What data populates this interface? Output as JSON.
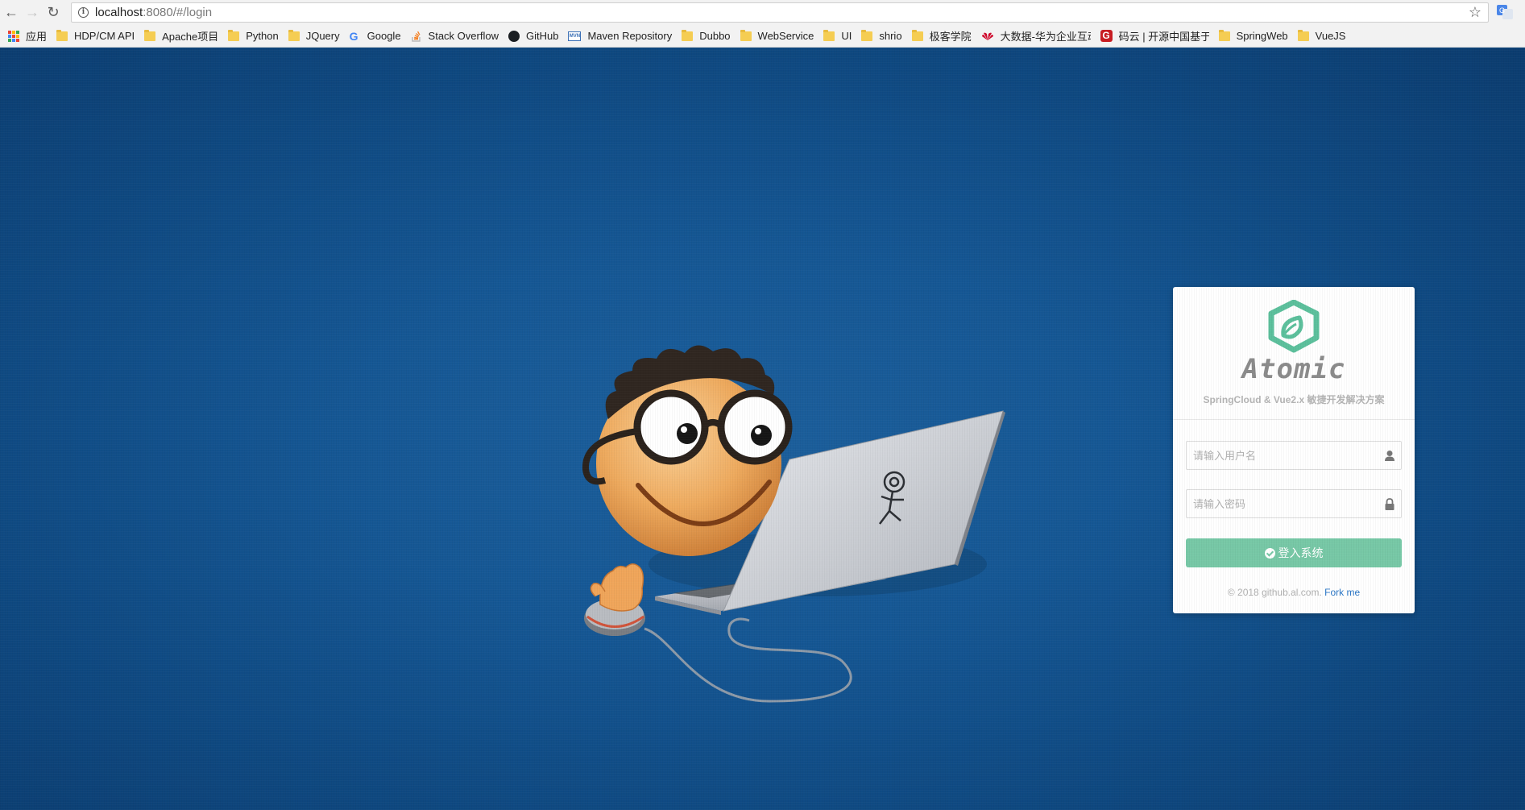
{
  "browser": {
    "url_host": "localhost",
    "url_rest": ":8080/#/login",
    "bookmarks": [
      {
        "label": "应用",
        "icon": "apps-grid-icon"
      },
      {
        "label": "HDP/CM API",
        "icon": "folder-icon"
      },
      {
        "label": "Apache项目",
        "icon": "folder-icon"
      },
      {
        "label": "Python",
        "icon": "folder-icon"
      },
      {
        "label": "JQuery",
        "icon": "folder-icon"
      },
      {
        "label": "Google",
        "icon": "google-icon"
      },
      {
        "label": "Stack Overflow",
        "icon": "stackoverflow-icon"
      },
      {
        "label": "GitHub",
        "icon": "github-icon"
      },
      {
        "label": "Maven Repository",
        "icon": "maven-icon"
      },
      {
        "label": "Dubbo",
        "icon": "folder-icon"
      },
      {
        "label": "WebService",
        "icon": "folder-icon"
      },
      {
        "label": "UI",
        "icon": "folder-icon"
      },
      {
        "label": "shrio",
        "icon": "folder-icon"
      },
      {
        "label": "极客学院",
        "icon": "folder-icon"
      },
      {
        "label": "大数据-华为企业互动",
        "icon": "huawei-icon"
      },
      {
        "label": "码云 | 开源中国基于G",
        "icon": "gitee-icon"
      },
      {
        "label": "SpringWeb",
        "icon": "folder-icon"
      },
      {
        "label": "VueJS",
        "icon": "folder-icon"
      }
    ]
  },
  "login": {
    "logo_text": "Atomic",
    "subtitle": "SpringCloud & Vue2.x 敏捷开发解决方案",
    "username_placeholder": "请输入用户名",
    "password_placeholder": "请输入密码",
    "login_button": "登入系统",
    "copyright": "© 2018 github.al.com.",
    "fork_link": "Fork me"
  },
  "colors": {
    "background": "#0f4a82",
    "accent": "#77c8a6",
    "link": "#2a76c6"
  }
}
